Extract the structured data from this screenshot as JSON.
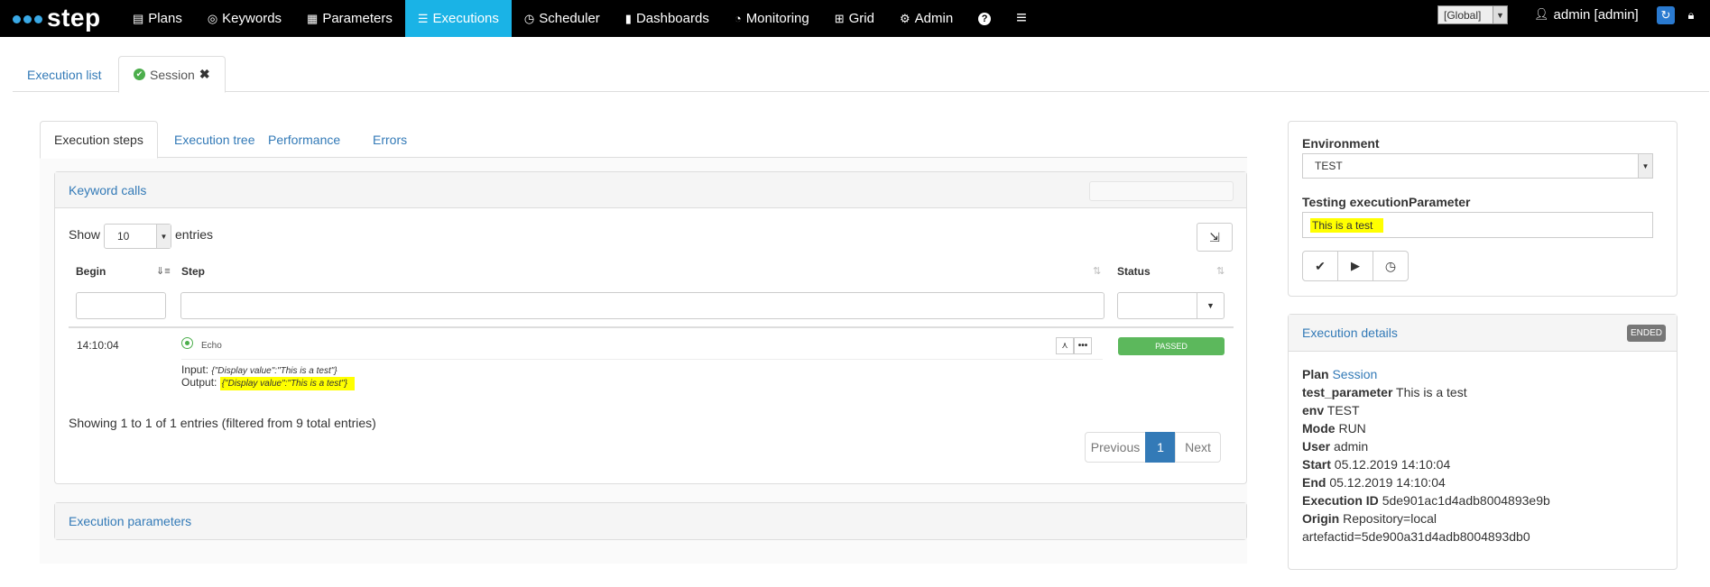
{
  "nav": {
    "brand": "step",
    "items": [
      {
        "icon": "file-icon",
        "glyph": "▤",
        "label": "Plans"
      },
      {
        "icon": "keyword-icon",
        "glyph": "◎",
        "label": "Keywords"
      },
      {
        "icon": "parameters-icon",
        "glyph": "▦",
        "label": "Parameters"
      },
      {
        "icon": "executions-icon",
        "glyph": "☰",
        "label": "Executions",
        "active": true
      },
      {
        "icon": "clock-icon",
        "glyph": "◷",
        "label": "Scheduler"
      },
      {
        "icon": "bar-chart-icon",
        "glyph": "▮",
        "label": "Dashboards"
      },
      {
        "icon": "dashboard-icon",
        "glyph": "◔",
        "label": "Monitoring"
      },
      {
        "icon": "grid-icon",
        "glyph": "⊞",
        "label": "Grid"
      },
      {
        "icon": "gear-icon",
        "glyph": "⚙",
        "label": "Admin"
      },
      {
        "icon": "help-icon",
        "glyph": "?",
        "label": ""
      },
      {
        "icon": "menu-icon",
        "glyph": "≡",
        "label": ""
      }
    ],
    "tenant": "[Global]",
    "user": "admin [admin]"
  },
  "tabs": {
    "execution_list": "Execution list",
    "session": "Session"
  },
  "subtabs": [
    "Execution steps",
    "Execution tree",
    "Performance",
    "Errors"
  ],
  "keyword_calls": {
    "title": "Keyword calls",
    "show": "Show",
    "page_size": "10",
    "entries": "entries",
    "columns": {
      "begin": "Begin",
      "step": "Step",
      "status": "Status"
    },
    "row": {
      "begin": "14:10:04",
      "step": "Echo",
      "status": "PASSED",
      "input_label": "Input:",
      "input_value": "{\"Display value\":\"This is a test\"}",
      "output_label": "Output:",
      "output_value": "{\"Display value\":\"This is a test\"}"
    },
    "info": "Showing 1 to 1 of 1 entries (filtered from 9 total entries)",
    "pagination": {
      "previous": "Previous",
      "current": "1",
      "next": "Next"
    }
  },
  "execution_parameters": {
    "title": "Execution parameters"
  },
  "environment": {
    "label": "Environment",
    "value": "TEST",
    "param_label": "Testing executionParameter",
    "param_value": "This is a test"
  },
  "details": {
    "title": "Execution details",
    "badge": "ENDED",
    "plan_label": "Plan",
    "plan_value": "Session",
    "rows": [
      {
        "k": "test_parameter",
        "v": "This is a test"
      },
      {
        "k": "env",
        "v": "TEST"
      },
      {
        "k": "Mode",
        "v": "RUN"
      },
      {
        "k": "User",
        "v": "admin"
      },
      {
        "k": "Start",
        "v": "05.12.2019 14:10:04"
      },
      {
        "k": "End",
        "v": "05.12.2019 14:10:04"
      },
      {
        "k": "Execution ID",
        "v": "5de901ac1d4adb8004893e9b"
      },
      {
        "k": "Origin",
        "v": "Repository=local"
      }
    ],
    "origin_cont": "artefactid=5de900a31d4adb8004893db0"
  },
  "colors": {
    "accent": "#1ab3e6",
    "passed": "#5cb85c",
    "highlight": "#ffff00",
    "link": "#337ab7"
  }
}
